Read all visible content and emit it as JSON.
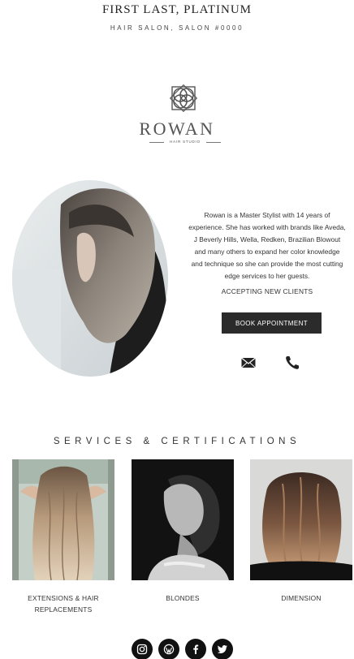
{
  "header": {
    "name": "FIRST LAST, PLATINUM",
    "subtitle": "HAIR SALON, SALON #0000"
  },
  "logo": {
    "wordmark": "ROWAN",
    "tagline": "HAIR STUDIO",
    "icon": "interlocking-circles-logo"
  },
  "profile": {
    "photo": "stylist-portrait",
    "bio": "Rowan is a Master Stylist with 14 years of experience. She has worked with brands like Aveda, J Beverly Hills, Wella, Redken, Brazilian Blowout and many others to expand her color knowledge and technique so she can provide the most cutting edge services to her guests.",
    "status": "ACCEPTING NEW CLIENTS",
    "book_label": "BOOK APPOINTMENT",
    "contact_icons": [
      "envelope-icon",
      "phone-icon"
    ]
  },
  "services": {
    "title": "SERVICES & CERTIFICATIONS",
    "items": [
      {
        "label": "EXTENSIONS & HAIR REPLACEMENTS",
        "image": "long-wavy-hair-back-view"
      },
      {
        "label": "BLONDES",
        "image": "black-and-white-portrait"
      },
      {
        "label": "DIMENSION",
        "image": "brunette-bob-balayage"
      }
    ]
  },
  "social": [
    "instagram-icon",
    "wordpress-icon",
    "facebook-icon",
    "twitter-icon"
  ],
  "colors": {
    "button_bg": "#2b2b2b",
    "text": "#333333",
    "background": "#ffffff"
  }
}
